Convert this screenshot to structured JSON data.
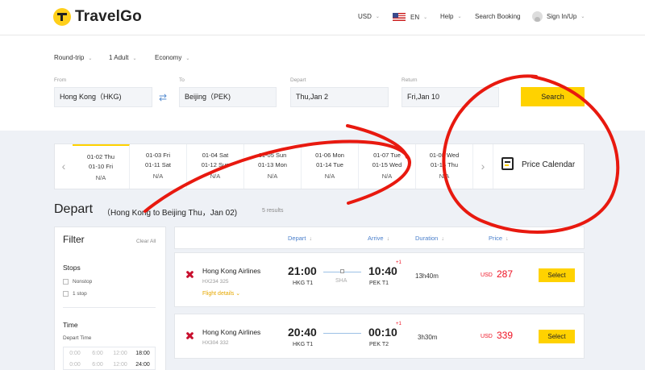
{
  "header": {
    "brand": "TravelGo",
    "currency": "USD",
    "language": "EN",
    "help": "Help",
    "search_booking": "Search Booking",
    "sign_in": "Sign In/Up"
  },
  "search": {
    "trip_type": "Round-trip",
    "passengers": "1 Adult",
    "cabin": "Economy",
    "from_label": "From",
    "from_value": "Hong Kong（HKG)",
    "to_label": "To",
    "to_value": "Beijing（PEK)",
    "depart_label": "Depart",
    "depart_value": "Thu,Jan 2",
    "return_label": "Return",
    "return_value": "Fri,Jan 10",
    "search_button": "Search"
  },
  "date_strip": {
    "cells": [
      {
        "line1": "01-02 Thu",
        "line2": "01-10 Fri",
        "price": "N/A",
        "active": true
      },
      {
        "line1": "01-03 Fri",
        "line2": "01-11 Sat",
        "price": "N/A"
      },
      {
        "line1": "01-04 Sat",
        "line2": "01-12 Sun",
        "price": "N/A"
      },
      {
        "line1": "01-05 Sun",
        "line2": "01-13 Mon",
        "price": "N/A"
      },
      {
        "line1": "01-06 Mon",
        "line2": "01-14 Tue",
        "price": "N/A"
      },
      {
        "line1": "01-07 Tue",
        "line2": "01-15 Wed",
        "price": "N/A"
      },
      {
        "line1": "01-08 Wed",
        "line2": "01-16 Thu",
        "price": "N/A"
      }
    ],
    "price_calendar": "Price Calendar"
  },
  "results_header": {
    "title": "Depart",
    "route": "（Hong Kong to Beijing  Thu，Jan 02)",
    "count": "5 results",
    "columns": {
      "depart": "Depart",
      "arrive": "Arrive",
      "duration": "Duration",
      "price": "Price"
    },
    "sort_arrow": "↓"
  },
  "filter": {
    "title": "Filter",
    "clear_all": "Clear All",
    "stops_title": "Stops",
    "stops": [
      "Nonstop",
      "1 stop"
    ],
    "time_title": "Time",
    "depart_time_label": "Depart Time",
    "times": [
      "0:00",
      "6:00",
      "12:00",
      "18:00",
      "0:00",
      "6:00",
      "12:00",
      "24:00"
    ],
    "times_selected": [
      false,
      false,
      false,
      true,
      false,
      false,
      false,
      true
    ]
  },
  "flights": [
    {
      "airline": "Hong Kong Airlines",
      "flight_no": "HX234 325",
      "details": "Flight details",
      "dep_time": "21:00",
      "dep_airport": "HKG T1",
      "stop_city": "SHA",
      "arr_time": "10:40",
      "arr_airport": "PEK T1",
      "day_offset": "+1",
      "duration": "13h40m",
      "currency": "USD",
      "price": "287",
      "select": "Select"
    },
    {
      "airline": "Hong Kong Airlines",
      "flight_no": "HX304 332",
      "dep_time": "20:40",
      "dep_airport": "HKG T1",
      "arr_time": "00:10",
      "arr_airport": "PEK T2",
      "day_offset": "+1",
      "duration": "3h30m",
      "currency": "USD",
      "price": "339",
      "select": "Select"
    }
  ],
  "colors": {
    "accent_yellow": "#ffd200",
    "price_red": "#ee1122",
    "annotation_red": "#e8190f",
    "link_blue": "#4a7fcb"
  },
  "icons": [
    "logo-icon",
    "caret-down-icon",
    "us-flag-icon",
    "user-avatar-icon",
    "swap-icon",
    "chevron-left-icon",
    "chevron-right-icon",
    "calendar-icon",
    "airline-logo-icon",
    "chevron-down-icon"
  ]
}
